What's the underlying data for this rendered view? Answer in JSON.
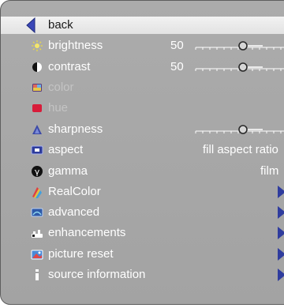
{
  "menu": {
    "items": [
      {
        "label": "back"
      },
      {
        "label": "brightness",
        "value": "50"
      },
      {
        "label": "contrast",
        "value": "50"
      },
      {
        "label": "color"
      },
      {
        "label": "hue"
      },
      {
        "label": "sharpness"
      },
      {
        "label": "aspect",
        "value": "fill aspect ratio"
      },
      {
        "label": "gamma",
        "value": "film"
      },
      {
        "label": "RealColor"
      },
      {
        "label": "advanced"
      },
      {
        "label": "enhancements"
      },
      {
        "label": "picture reset"
      },
      {
        "label": "source information"
      }
    ]
  },
  "colors": {
    "panel": "#a8a8a8",
    "selected_row": "#eeeeee",
    "arrow_blue": "#2f3c9e"
  },
  "icons": [
    "back-arrow-icon",
    "sun-icon",
    "contrast-icon",
    "color-icon",
    "hue-icon",
    "sharpness-icon",
    "aspect-icon",
    "gamma-icon",
    "realcolor-icon",
    "advanced-icon",
    "enhancements-icon",
    "picture-reset-icon",
    "info-icon"
  ]
}
